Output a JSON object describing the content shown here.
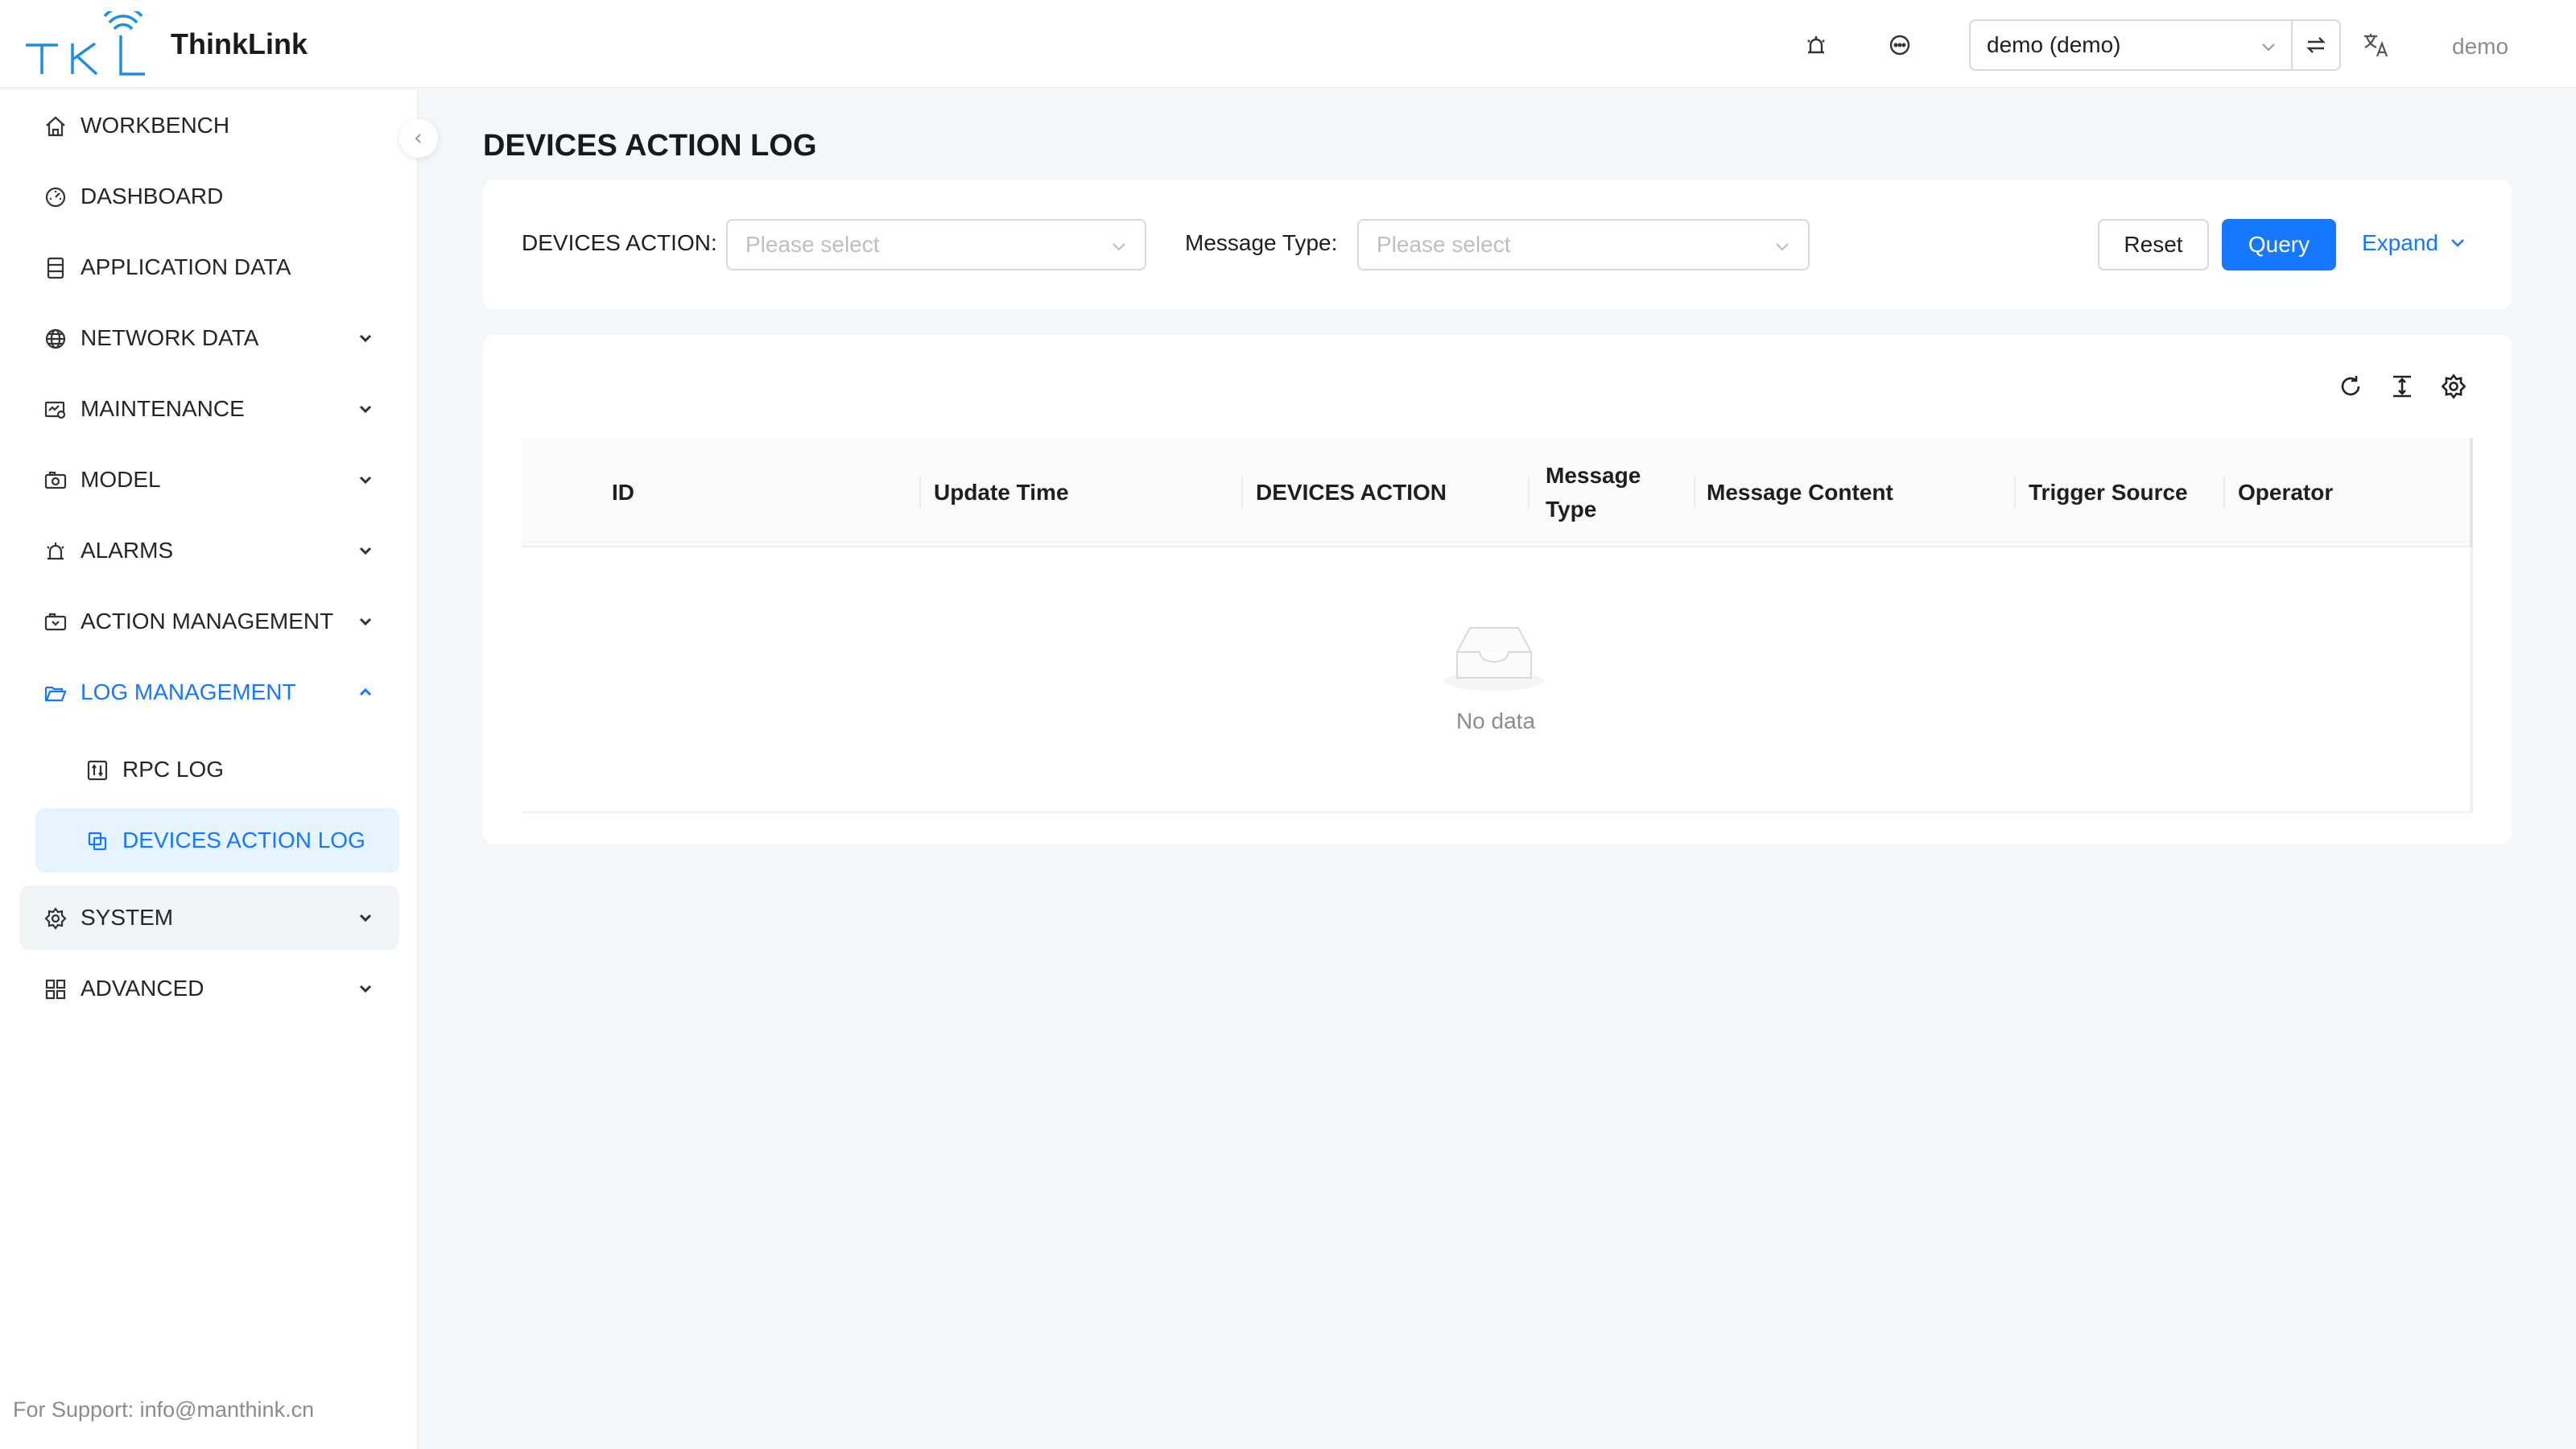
{
  "app": {
    "brand": "ThinkLink",
    "logo_text": "TKL"
  },
  "header": {
    "tenant_selected": "demo (demo)",
    "user_name": "demo",
    "icons": [
      "alarm-icon",
      "message-icon",
      "switch-icon",
      "translate-icon"
    ]
  },
  "sidebar": {
    "items": [
      {
        "label": "WORKBENCH",
        "icon": "home-icon"
      },
      {
        "label": "DASHBOARD",
        "icon": "dashboard-icon"
      },
      {
        "label": "APPLICATION DATA",
        "icon": "database-icon"
      },
      {
        "label": "NETWORK DATA",
        "icon": "globe-icon"
      },
      {
        "label": "MAINTENANCE",
        "icon": "maintenance-icon"
      },
      {
        "label": "MODEL",
        "icon": "model-icon"
      },
      {
        "label": "ALARMS",
        "icon": "alarm-icon"
      },
      {
        "label": "ACTION MANAGEMENT",
        "icon": "action-icon"
      },
      {
        "label": "LOG MANAGEMENT",
        "icon": "folder-open-icon"
      },
      {
        "label": "RPC LOG",
        "icon": "rpc-log-icon"
      },
      {
        "label": "DEVICES ACTION LOG",
        "icon": "copy-icon"
      },
      {
        "label": "SYSTEM",
        "icon": "gear-icon"
      },
      {
        "label": "ADVANCED",
        "icon": "grid-icon"
      }
    ],
    "support": "For Support: info@manthink.cn"
  },
  "main": {
    "title": "DEVICES ACTION LOG",
    "filters": {
      "action_label": "DEVICES ACTION",
      "action_placeholder": "Please select",
      "type_label": "Message Type",
      "type_placeholder": "Please select",
      "reset": "Reset",
      "query": "Query",
      "expand": "Expand"
    },
    "table": {
      "columns": [
        "ID",
        "Update Time",
        "DEVICES ACTION",
        "Message Type",
        "Message Content",
        "Trigger Source",
        "Operator"
      ],
      "empty_text": "No data"
    }
  },
  "colors": {
    "accent": "#1677ff",
    "active_bg": "#e6f4ff"
  }
}
